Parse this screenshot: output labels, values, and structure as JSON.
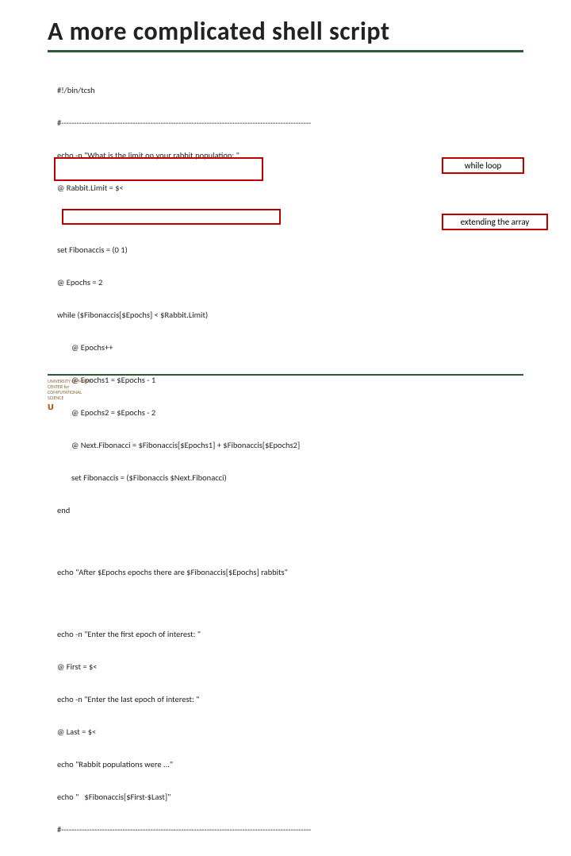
{
  "title": "A more complicated shell script",
  "code": {
    "b1l1": "#!/bin/tcsh",
    "b1l2": "#--------------------------------------------------------------------------------------------------",
    "b1l3": "echo -n \"What is the limit on your rabbit population: \"",
    "b1l4": "@ Rabbit.Limit = $<",
    "b2l1": "set Fibonaccis = (0 1)",
    "b2l2": "@ Epochs = 2",
    "b2l3": "while ($Fibonaccis[$Epochs] < $Rabbit.Limit)",
    "b2l4": "@ Epochs++",
    "b2l5": "@ Epochs1 = $Epochs - 1",
    "b2l6": "@ Epochs2 = $Epochs - 2",
    "b2l7": "@ Next.Fibonacci = $Fibonaccis[$Epochs1] + $Fibonaccis[$Epochs2]",
    "b2l8": "set Fibonaccis = ($Fibonaccis $Next.Fibonacci)",
    "b2l9": "end",
    "b3l1": "echo \"After $Epochs epochs there are $Fibonaccis[$Epochs] rabbits\"",
    "b4l1": "echo -n \"Enter the first epoch of interest: \"",
    "b4l2": "@ First = $<",
    "b4l3": "echo -n \"Enter the last epoch of interest: \"",
    "b4l4": "@ Last = $<",
    "b4l5": "echo \"Rabbit populations were ...\"",
    "b4l6": "echo \"   $Fibonaccis[$First-$Last]\"",
    "b4l7": "#--------------------------------------------------------------------------------------------------"
  },
  "labels": {
    "while_loop": "while loop",
    "extending": "extending the array"
  },
  "footer": {
    "line1": "UNIVERSITY OF MIAMI",
    "line2": "CENTER for",
    "line3": "COMPUTATIONAL",
    "line4": "SCIENCE"
  }
}
